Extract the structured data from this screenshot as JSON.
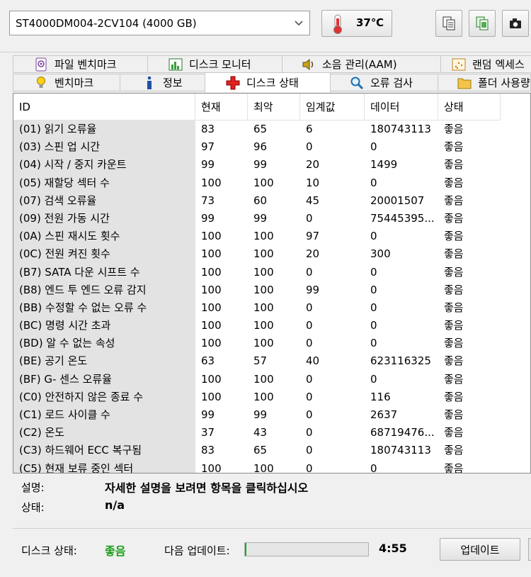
{
  "drive": {
    "selected": "ST4000DM004-2CV104 (4000 GB)"
  },
  "temperature": "37℃",
  "toolbar_icons": [
    "copy-icon",
    "copy-all-icon",
    "screenshot-icon"
  ],
  "tabs_row1": [
    {
      "label": "파일 벤치마크",
      "icon": "file-benchmark-icon"
    },
    {
      "label": "디스크 모니터",
      "icon": "disk-monitor-icon"
    },
    {
      "label": "소음 관리(AAM)",
      "icon": "speaker-icon"
    },
    {
      "label": "랜덤 엑세스",
      "icon": "random-access-icon"
    }
  ],
  "tabs_row2": [
    {
      "label": "벤치마크",
      "icon": "lightbulb-icon"
    },
    {
      "label": "정보",
      "icon": "info-icon"
    },
    {
      "label": "디스크 상태",
      "icon": "health-cross-icon",
      "active": true
    },
    {
      "label": "오류 검사",
      "icon": "magnifier-icon"
    },
    {
      "label": "폴더 사용량",
      "icon": "folder-icon"
    }
  ],
  "columns": [
    "ID",
    "현재",
    "최악",
    "임계값",
    "데이터",
    "상태"
  ],
  "rows": [
    {
      "id": "(01) 읽기 오류율",
      "cur": "83",
      "worst": "65",
      "thr": "6",
      "data": "180743113",
      "status": "좋음"
    },
    {
      "id": "(03) 스핀 업 시간",
      "cur": "97",
      "worst": "96",
      "thr": "0",
      "data": "0",
      "status": "좋음"
    },
    {
      "id": "(04) 시작 / 중지 카운트",
      "cur": "99",
      "worst": "99",
      "thr": "20",
      "data": "1499",
      "status": "좋음"
    },
    {
      "id": "(05) 재할당 섹터 수",
      "cur": "100",
      "worst": "100",
      "thr": "10",
      "data": "0",
      "status": "좋음"
    },
    {
      "id": "(07) 검색 오류율",
      "cur": "73",
      "worst": "60",
      "thr": "45",
      "data": "20001507",
      "status": "좋음"
    },
    {
      "id": "(09) 전원 가동 시간",
      "cur": "99",
      "worst": "99",
      "thr": "0",
      "data": "75445395...",
      "status": "좋음"
    },
    {
      "id": "(0A) 스핀 재시도 횟수",
      "cur": "100",
      "worst": "100",
      "thr": "97",
      "data": "0",
      "status": "좋음"
    },
    {
      "id": "(0C) 전원 켜진 횟수",
      "cur": "100",
      "worst": "100",
      "thr": "20",
      "data": "300",
      "status": "좋음"
    },
    {
      "id": "(B7) SATA 다운 시프트 수",
      "cur": "100",
      "worst": "100",
      "thr": "0",
      "data": "0",
      "status": "좋음"
    },
    {
      "id": "(B8) 엔드 투 엔드 오류 감지",
      "cur": "100",
      "worst": "100",
      "thr": "99",
      "data": "0",
      "status": "좋음"
    },
    {
      "id": "(BB) 수정할 수 없는 오류 수",
      "cur": "100",
      "worst": "100",
      "thr": "0",
      "data": "0",
      "status": "좋음"
    },
    {
      "id": "(BC) 명령 시간 초과",
      "cur": "100",
      "worst": "100",
      "thr": "0",
      "data": "0",
      "status": "좋음"
    },
    {
      "id": "(BD) 알 수 없는 속성",
      "cur": "100",
      "worst": "100",
      "thr": "0",
      "data": "0",
      "status": "좋음"
    },
    {
      "id": "(BE) 공기 온도",
      "cur": "63",
      "worst": "57",
      "thr": "40",
      "data": "623116325",
      "status": "좋음"
    },
    {
      "id": "(BF) G- 센스 오류율",
      "cur": "100",
      "worst": "100",
      "thr": "0",
      "data": "0",
      "status": "좋음"
    },
    {
      "id": "(C0) 안전하지 않은 종료 수",
      "cur": "100",
      "worst": "100",
      "thr": "0",
      "data": "116",
      "status": "좋음"
    },
    {
      "id": "(C1) 로드 사이클 수",
      "cur": "99",
      "worst": "99",
      "thr": "0",
      "data": "2637",
      "status": "좋음"
    },
    {
      "id": "(C2) 온도",
      "cur": "37",
      "worst": "43",
      "thr": "0",
      "data": "68719476...",
      "status": "좋음"
    },
    {
      "id": "(C3) 하드웨어 ECC 복구됨",
      "cur": "83",
      "worst": "65",
      "thr": "0",
      "data": "180743113",
      "status": "좋음"
    },
    {
      "id": "(C5) 현재 보류 중인 섹터",
      "cur": "100",
      "worst": "100",
      "thr": "0",
      "data": "0",
      "status": "좋음"
    }
  ],
  "description": {
    "label": "설명:",
    "value": "자세한 설명을 보려면 항목을 클릭하십시오"
  },
  "state": {
    "label": "상태:",
    "value": "n/a"
  },
  "footer": {
    "disk_status_label": "디스크 상태:",
    "disk_status_value": "좋음",
    "disk_status_color": "#1aa01a",
    "next_update_label": "다음 업데이트:",
    "progress_fraction": 0.01,
    "timer": "4:55",
    "update_button": "업데이트"
  }
}
